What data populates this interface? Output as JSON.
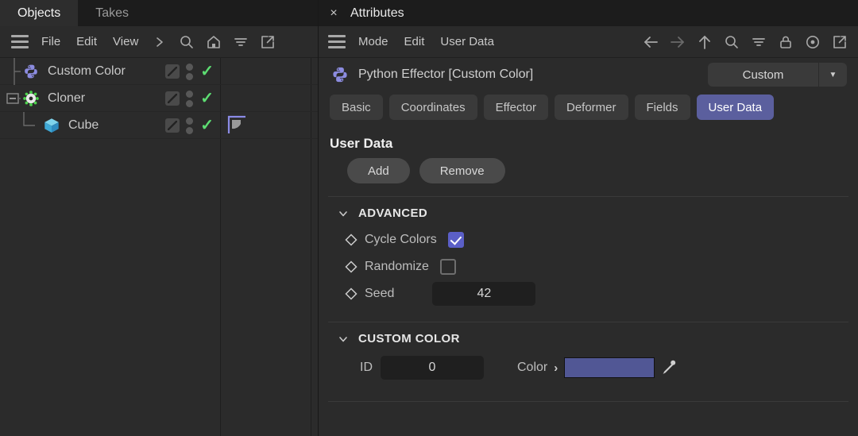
{
  "objects_panel": {
    "tabs": [
      {
        "label": "Objects",
        "active": true
      },
      {
        "label": "Takes",
        "active": false
      }
    ],
    "toolbar": {
      "menu_icon": "hamburger-icon",
      "menus": [
        "File",
        "Edit",
        "View"
      ],
      "icons": [
        "chevron-right-icon",
        "search-icon",
        "home-icon",
        "filter-icon",
        "external-link-icon"
      ]
    },
    "tree": [
      {
        "name": "Custom Color",
        "icon": "python-icon",
        "depth": 1,
        "expander": "",
        "edit_tag": "edit-square-icon",
        "visibility_dots": 2,
        "enabled_check": "✓",
        "tag": null
      },
      {
        "name": "Cloner",
        "icon": "cloner-gear-icon",
        "depth": 0,
        "expander": "−",
        "edit_tag": "edit-square-icon",
        "visibility_dots": 2,
        "enabled_check": "✓",
        "tag": null
      },
      {
        "name": "Cube",
        "icon": "cube-icon",
        "depth": 2,
        "expander": "",
        "edit_tag": "edit-square-icon",
        "visibility_dots": 2,
        "enabled_check": "✓",
        "tag": "corner-tag-icon"
      }
    ]
  },
  "attributes_panel": {
    "close_label": "×",
    "title": "Attributes",
    "toolbar": {
      "menu_icon": "hamburger-icon",
      "menus": [
        "Mode",
        "Edit",
        "User Data"
      ],
      "icons": [
        "arrow-left-icon",
        "arrow-right-icon",
        "arrow-up-icon",
        "search-icon",
        "filter-icon",
        "lock-icon",
        "target-icon",
        "external-link-icon"
      ]
    },
    "object_header": {
      "icon": "python-icon",
      "title": "Python Effector [Custom Color]",
      "mode_value": "Custom",
      "mode_arrow": "▼"
    },
    "tabs": [
      {
        "label": "Basic",
        "active": false
      },
      {
        "label": "Coordinates",
        "active": false
      },
      {
        "label": "Effector",
        "active": false
      },
      {
        "label": "Deformer",
        "active": false
      },
      {
        "label": "Fields",
        "active": false
      },
      {
        "label": "User Data",
        "active": true
      }
    ],
    "user_data": {
      "heading": "User Data",
      "add_label": "Add",
      "remove_label": "Remove"
    },
    "groups": [
      {
        "label": "ADVANCED",
        "collapse_glyph": "⌄",
        "rows": [
          {
            "kind": "checkbox",
            "marker": "keyframe-diamond-icon",
            "label": "Cycle Colors",
            "checked": true
          },
          {
            "kind": "checkbox",
            "marker": "keyframe-diamond-icon",
            "label": "Randomize",
            "checked": false
          },
          {
            "kind": "number",
            "marker": "keyframe-diamond-icon",
            "label": "Seed",
            "value": "42"
          }
        ]
      },
      {
        "label": "CUSTOM COLOR",
        "collapse_glyph": "⌄",
        "rows": [
          {
            "kind": "id-color",
            "id_label": "ID",
            "id_value": "0",
            "color_label": "Color",
            "color_arrow": "›",
            "color_value": "#515795",
            "eyedropper": "eyedropper-icon"
          }
        ]
      }
    ]
  },
  "theme": {
    "accent": "#5b5f9e",
    "checkbox_accent": "#5b5fc7",
    "check_green": "#5ddd72",
    "panel_bg": "#2b2b2b",
    "tabbar_bg": "#1c1c1c",
    "field_bg": "#1f1f1f"
  }
}
